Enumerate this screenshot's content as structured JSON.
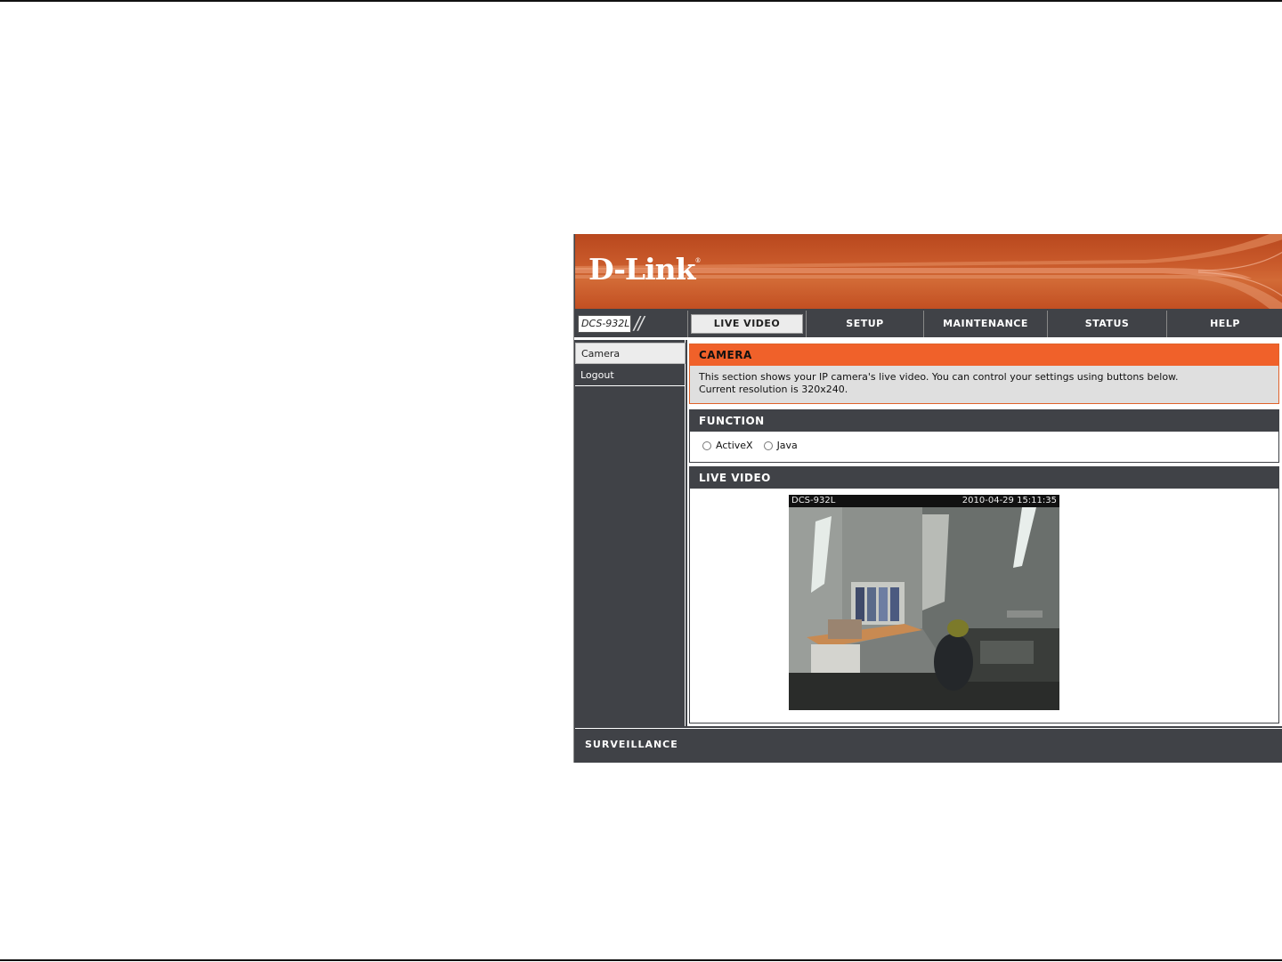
{
  "brand": {
    "logo": "D-Link",
    "model": "DCS-932L"
  },
  "nav": {
    "tabs": [
      {
        "label": "LIVE VIDEO",
        "active": true
      },
      {
        "label": "SETUP"
      },
      {
        "label": "MAINTENANCE"
      },
      {
        "label": "STATUS"
      },
      {
        "label": "HELP"
      }
    ]
  },
  "sidebar": {
    "items": [
      {
        "label": "Camera",
        "selected": true
      },
      {
        "label": "Logout"
      }
    ]
  },
  "camera": {
    "heading": "CAMERA",
    "description_line1": "This section shows your IP camera's live video. You can control your settings using buttons below.",
    "description_line2": "Current resolution is 320x240."
  },
  "function": {
    "heading": "FUNCTION",
    "options": [
      "ActiveX",
      "Java"
    ]
  },
  "live_video": {
    "heading": "LIVE VIDEO",
    "overlay_camera": "DCS-932L",
    "overlay_timestamp": "2010-04-29 15:11:35"
  },
  "footer": {
    "brand": "SURVEILLANCE"
  },
  "colors": {
    "accent": "#f0612a",
    "dark": "#404247"
  }
}
